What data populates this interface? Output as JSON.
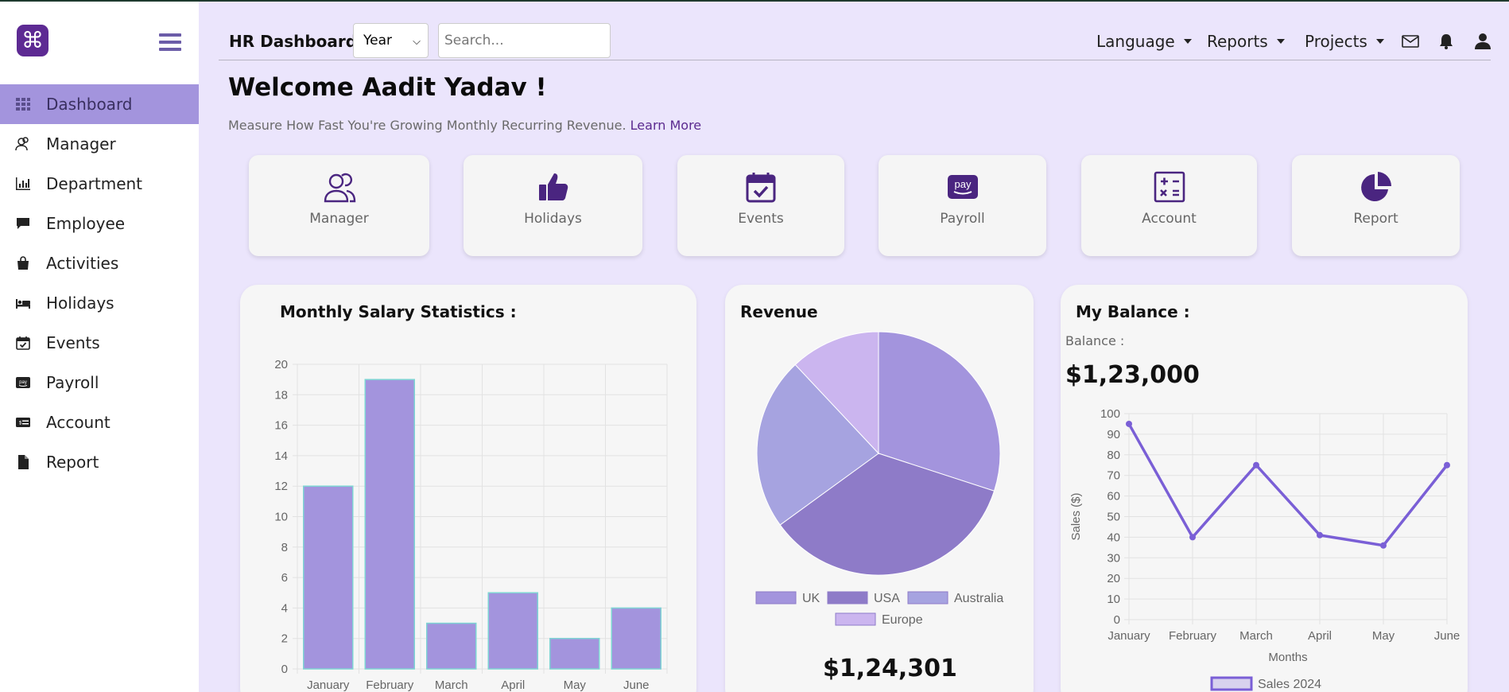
{
  "sidebar": {
    "logo_icon": "command-icon",
    "items": [
      {
        "label": "Dashboard",
        "icon": "grid-icon",
        "active": true
      },
      {
        "label": "Manager",
        "icon": "users-icon",
        "active": false
      },
      {
        "label": "Department",
        "icon": "bar-chart-icon",
        "active": false
      },
      {
        "label": "Employee",
        "icon": "chat-bubble-icon",
        "active": false
      },
      {
        "label": "Activities",
        "icon": "bag-icon",
        "active": false
      },
      {
        "label": "Holidays",
        "icon": "bed-icon",
        "active": false
      },
      {
        "label": "Events",
        "icon": "calendar-check-icon",
        "active": false
      },
      {
        "label": "Payroll",
        "icon": "pay-icon",
        "active": false
      },
      {
        "label": "Account",
        "icon": "money-card-icon",
        "active": false
      },
      {
        "label": "Report",
        "icon": "file-icon",
        "active": false
      }
    ]
  },
  "header": {
    "title": "HR Dashboard",
    "period_select": "Year",
    "search_placeholder": "Search...",
    "menus": [
      "Language",
      "Reports",
      "Projects"
    ]
  },
  "welcome": {
    "heading": "Welcome Aadit Yadav !",
    "subtitle": "Measure How Fast You're Growing Monthly Recurring Revenue.",
    "link": "Learn More"
  },
  "cards": [
    {
      "label": "Manager",
      "icon": "users-icon"
    },
    {
      "label": "Holidays",
      "icon": "thumbs-up-icon"
    },
    {
      "label": "Events",
      "icon": "calendar-check-icon"
    },
    {
      "label": "Payroll",
      "icon": "pay-icon"
    },
    {
      "label": "Account",
      "icon": "calculator-icon"
    },
    {
      "label": "Report",
      "icon": "pie-chart-icon"
    }
  ],
  "colors": {
    "accent": "#a394dd",
    "brand": "#5d2a93",
    "bar_fill": "#a394dd",
    "bar_border": "#7ed4d4",
    "line": "#7a5fd6"
  },
  "salary_panel": {
    "title": "Monthly Salary Statistics :"
  },
  "revenue_panel": {
    "title": "Revenue",
    "amount": "$1,24,301"
  },
  "balance_panel": {
    "title": "My Balance :",
    "label": "Balance :",
    "amount": "$1,23,000"
  },
  "chart_data": [
    {
      "type": "bar",
      "categories": [
        "January",
        "February",
        "March",
        "April",
        "May",
        "June"
      ],
      "values": [
        12,
        19,
        3,
        5,
        2,
        4
      ],
      "ylim": [
        0,
        20
      ],
      "yticks": [
        0,
        2,
        4,
        6,
        8,
        10,
        12,
        14,
        16,
        18,
        20
      ],
      "grid": true,
      "legend": "none"
    },
    {
      "type": "pie",
      "labels": [
        "UK",
        "USA",
        "Australia",
        "Europe"
      ],
      "values": [
        30,
        35,
        23,
        12
      ],
      "colors": [
        "#a394dd",
        "#8e7bc8",
        "#a6a3e0",
        "#cbb5ef"
      ],
      "legend": "bottom"
    },
    {
      "type": "line",
      "x": [
        "January",
        "February",
        "March",
        "April",
        "May",
        "June"
      ],
      "series": [
        {
          "name": "Sales 2024",
          "values": [
            95,
            40,
            75,
            41,
            36,
            75
          ]
        }
      ],
      "ylim": [
        0,
        100
      ],
      "yticks": [
        0,
        10,
        20,
        30,
        40,
        50,
        60,
        70,
        80,
        90,
        100
      ],
      "xlabel": "Months",
      "ylabel": "Sales ($)",
      "grid": true,
      "legend": "bottom"
    }
  ]
}
